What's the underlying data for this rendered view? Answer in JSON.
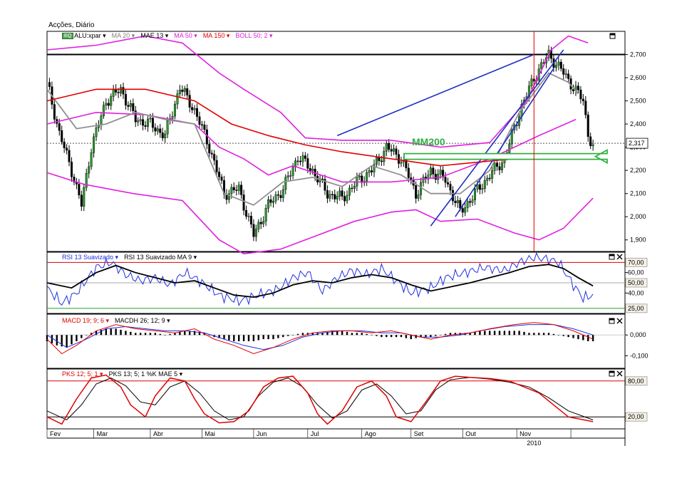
{
  "window_title": "Acções, Diário",
  "legend_price": {
    "eq_badge": "EQ",
    "symbol": "ALU:xpar ▾",
    "items": [
      {
        "text": "MA 20 ▾",
        "color": "#808080"
      },
      {
        "text": "MAE 13 ▾",
        "color": "#000000"
      },
      {
        "text": "MA 50 ▾",
        "color": "#e020e0"
      },
      {
        "text": "MA 150 ▾",
        "color": "#e00000"
      },
      {
        "text": "BOLL 50; 2 ▾",
        "color": "#e020e0"
      }
    ]
  },
  "legend_rsi": {
    "items": [
      {
        "text": "RSI 13 Suavizado ▾",
        "color": "#2030e0"
      },
      {
        "text": "RSI 13 Suavizado MA 9 ▾",
        "color": "#000000"
      }
    ]
  },
  "legend_macd": {
    "items": [
      {
        "text": "MACD 19; 9; 6 ▾",
        "color": "#e00000"
      },
      {
        "text": "MACDH 26; 12; 9 ▾",
        "color": "#000000"
      }
    ]
  },
  "legend_pks": {
    "items": [
      {
        "text": "PKS 12; 5; 1 ▾",
        "color": "#e00000"
      },
      {
        "text": "PKS 13; 5; 1 %K MAE 5 ▾",
        "color": "#000000"
      }
    ]
  },
  "annotation": {
    "text": "MM200",
    "color": "#30b040"
  },
  "price_readout": "2,317",
  "year_label": "2010",
  "chart_data": {
    "type": "line",
    "x_months": [
      "Fev",
      "Mar",
      "Abr",
      "Mai",
      "Jun",
      "Jul",
      "Ago",
      "Set",
      "Out",
      "Nov"
    ],
    "price_axis": {
      "ticks": [
        "2,700",
        "2,600",
        "2,500",
        "2,400",
        "2,300",
        "2,200",
        "2,100",
        "2,000",
        "1,900"
      ],
      "ylim": [
        1.85,
        2.8
      ]
    },
    "rsi_axis": {
      "ticks": [
        "70,00",
        "60,00",
        "50,00",
        "40,00",
        "25,00"
      ],
      "boxed": [
        "70,00",
        "50,00",
        "25,00"
      ],
      "ylim": [
        20,
        80
      ]
    },
    "macd_axis": {
      "ticks": [
        "0,000",
        "-0,100"
      ],
      "ylim": [
        -0.16,
        0.1
      ]
    },
    "pks_axis": {
      "ticks": [
        "80,00",
        "20,00"
      ],
      "boxed": [
        "80,00",
        "20,00"
      ],
      "ylim": [
        0,
        100
      ]
    },
    "close_points": [
      [
        0,
        2.58
      ],
      [
        5,
        2.36
      ],
      [
        10,
        2.2
      ],
      [
        14,
        2.05
      ],
      [
        18,
        2.3
      ],
      [
        24,
        2.5
      ],
      [
        30,
        2.55
      ],
      [
        36,
        2.42
      ],
      [
        42,
        2.4
      ],
      [
        48,
        2.35
      ],
      [
        54,
        2.56
      ],
      [
        60,
        2.46
      ],
      [
        66,
        2.3
      ],
      [
        72,
        2.1
      ],
      [
        78,
        2.12
      ],
      [
        84,
        1.92
      ],
      [
        90,
        2.05
      ],
      [
        96,
        2.12
      ],
      [
        102,
        2.26
      ],
      [
        108,
        2.2
      ],
      [
        114,
        2.1
      ],
      [
        120,
        2.08
      ],
      [
        126,
        2.15
      ],
      [
        132,
        2.2
      ],
      [
        138,
        2.3
      ],
      [
        144,
        2.25
      ],
      [
        150,
        2.1
      ],
      [
        156,
        2.2
      ],
      [
        162,
        2.16
      ],
      [
        168,
        2.02
      ],
      [
        174,
        2.1
      ],
      [
        180,
        2.18
      ],
      [
        186,
        2.25
      ],
      [
        192,
        2.45
      ],
      [
        198,
        2.6
      ],
      [
        204,
        2.7
      ],
      [
        210,
        2.62
      ],
      [
        214,
        2.56
      ],
      [
        218,
        2.5
      ],
      [
        220,
        2.36
      ],
      [
        222,
        2.3
      ]
    ],
    "ma20": [
      [
        0,
        2.55
      ],
      [
        12,
        2.38
      ],
      [
        24,
        2.4
      ],
      [
        36,
        2.45
      ],
      [
        48,
        2.42
      ],
      [
        60,
        2.4
      ],
      [
        72,
        2.1
      ],
      [
        84,
        2.05
      ],
      [
        96,
        2.15
      ],
      [
        108,
        2.17
      ],
      [
        120,
        2.13
      ],
      [
        132,
        2.22
      ],
      [
        144,
        2.18
      ],
      [
        156,
        2.1
      ],
      [
        168,
        2.1
      ],
      [
        180,
        2.2
      ],
      [
        192,
        2.45
      ],
      [
        204,
        2.62
      ],
      [
        212,
        2.58
      ],
      [
        216,
        2.53
      ]
    ],
    "ma50": [
      [
        0,
        2.4
      ],
      [
        20,
        2.45
      ],
      [
        40,
        2.44
      ],
      [
        60,
        2.4
      ],
      [
        70,
        2.3
      ],
      [
        80,
        2.25
      ],
      [
        90,
        2.18
      ],
      [
        100,
        2.22
      ],
      [
        120,
        2.15
      ],
      [
        140,
        2.15
      ],
      [
        160,
        2.17
      ],
      [
        180,
        2.25
      ],
      [
        200,
        2.35
      ],
      [
        215,
        2.42
      ]
    ],
    "ma150_mm200": [
      [
        0,
        2.5
      ],
      [
        20,
        2.55
      ],
      [
        40,
        2.55
      ],
      [
        60,
        2.5
      ],
      [
        75,
        2.4
      ],
      [
        90,
        2.35
      ],
      [
        105,
        2.31
      ],
      [
        120,
        2.28
      ],
      [
        140,
        2.25
      ],
      [
        160,
        2.22
      ],
      [
        180,
        2.24
      ],
      [
        200,
        2.26
      ],
      [
        222,
        2.26
      ]
    ],
    "boll_upper": [
      [
        0,
        2.72
      ],
      [
        20,
        2.74
      ],
      [
        40,
        2.78
      ],
      [
        55,
        2.75
      ],
      [
        70,
        2.62
      ],
      [
        80,
        2.55
      ],
      [
        95,
        2.45
      ],
      [
        105,
        2.34
      ],
      [
        120,
        2.33
      ],
      [
        140,
        2.33
      ],
      [
        160,
        2.3
      ],
      [
        180,
        2.32
      ],
      [
        195,
        2.5
      ],
      [
        205,
        2.72
      ],
      [
        212,
        2.78
      ],
      [
        220,
        2.75
      ]
    ],
    "boll_lower": [
      [
        0,
        2.19
      ],
      [
        15,
        2.14
      ],
      [
        35,
        2.1
      ],
      [
        55,
        2.07
      ],
      [
        70,
        1.9
      ],
      [
        80,
        1.84
      ],
      [
        95,
        1.86
      ],
      [
        110,
        1.92
      ],
      [
        125,
        1.98
      ],
      [
        140,
        2.02
      ],
      [
        150,
        2.03
      ],
      [
        160,
        1.98
      ],
      [
        175,
        1.99
      ],
      [
        190,
        1.93
      ],
      [
        200,
        1.9
      ],
      [
        210,
        1.95
      ],
      [
        222,
        2.08
      ]
    ],
    "trendlines": [
      {
        "from": [
          118,
          2.35
        ],
        "to": [
          198,
          2.7
        ],
        "color": "#2030c0"
      },
      {
        "from": [
          156,
          1.96
        ],
        "to": [
          210,
          2.72
        ],
        "color": "#2030c0"
      },
      {
        "from": [
          166,
          2.0
        ],
        "to": [
          206,
          2.64
        ],
        "color": "#2030c0"
      }
    ],
    "resistance_level": 2.7,
    "current_level": 2.317,
    "rsi": [
      [
        0,
        45
      ],
      [
        6,
        30
      ],
      [
        12,
        40
      ],
      [
        20,
        65
      ],
      [
        26,
        70
      ],
      [
        32,
        58
      ],
      [
        38,
        52
      ],
      [
        44,
        55
      ],
      [
        50,
        48
      ],
      [
        56,
        60
      ],
      [
        62,
        52
      ],
      [
        70,
        38
      ],
      [
        78,
        32
      ],
      [
        86,
        38
      ],
      [
        94,
        44
      ],
      [
        100,
        55
      ],
      [
        106,
        60
      ],
      [
        112,
        42
      ],
      [
        118,
        55
      ],
      [
        124,
        62
      ],
      [
        130,
        58
      ],
      [
        136,
        64
      ],
      [
        142,
        52
      ],
      [
        148,
        40
      ],
      [
        156,
        45
      ],
      [
        162,
        55
      ],
      [
        170,
        60
      ],
      [
        178,
        65
      ],
      [
        186,
        62
      ],
      [
        192,
        70
      ],
      [
        198,
        75
      ],
      [
        204,
        73
      ],
      [
        208,
        70
      ],
      [
        214,
        48
      ],
      [
        218,
        35
      ],
      [
        222,
        38
      ]
    ],
    "rsi_ma": [
      [
        0,
        50
      ],
      [
        10,
        45
      ],
      [
        20,
        60
      ],
      [
        28,
        67
      ],
      [
        36,
        60
      ],
      [
        44,
        55
      ],
      [
        52,
        50
      ],
      [
        60,
        52
      ],
      [
        68,
        45
      ],
      [
        76,
        38
      ],
      [
        84,
        36
      ],
      [
        92,
        40
      ],
      [
        100,
        48
      ],
      [
        108,
        52
      ],
      [
        116,
        50
      ],
      [
        124,
        55
      ],
      [
        132,
        58
      ],
      [
        140,
        55
      ],
      [
        148,
        48
      ],
      [
        156,
        42
      ],
      [
        164,
        46
      ],
      [
        172,
        50
      ],
      [
        180,
        55
      ],
      [
        188,
        60
      ],
      [
        196,
        66
      ],
      [
        204,
        68
      ],
      [
        210,
        64
      ],
      [
        216,
        55
      ],
      [
        222,
        47
      ]
    ],
    "macd": [
      [
        0,
        -0.02
      ],
      [
        6,
        -0.09
      ],
      [
        12,
        -0.05
      ],
      [
        20,
        0.02
      ],
      [
        28,
        0.05
      ],
      [
        36,
        0.03
      ],
      [
        44,
        0.02
      ],
      [
        52,
        0.01
      ],
      [
        60,
        0.03
      ],
      [
        68,
        -0.02
      ],
      [
        76,
        -0.05
      ],
      [
        84,
        -0.09
      ],
      [
        92,
        -0.06
      ],
      [
        100,
        -0.02
      ],
      [
        108,
        0.01
      ],
      [
        116,
        0.02
      ],
      [
        124,
        0.02
      ],
      [
        132,
        0.01
      ],
      [
        140,
        0.02
      ],
      [
        148,
        0.0
      ],
      [
        156,
        -0.02
      ],
      [
        164,
        0.0
      ],
      [
        172,
        0.01
      ],
      [
        180,
        0.03
      ],
      [
        190,
        0.05
      ],
      [
        198,
        0.06
      ],
      [
        206,
        0.05
      ],
      [
        214,
        0.02
      ],
      [
        222,
        -0.02
      ]
    ],
    "macd_signal": [
      [
        0,
        0.0
      ],
      [
        8,
        -0.06
      ],
      [
        16,
        -0.02
      ],
      [
        24,
        0.03
      ],
      [
        32,
        0.04
      ],
      [
        40,
        0.03
      ],
      [
        48,
        0.02
      ],
      [
        56,
        0.02
      ],
      [
        64,
        0.01
      ],
      [
        72,
        -0.02
      ],
      [
        80,
        -0.05
      ],
      [
        88,
        -0.07
      ],
      [
        96,
        -0.05
      ],
      [
        104,
        -0.01
      ],
      [
        112,
        0.01
      ],
      [
        120,
        0.02
      ],
      [
        128,
        0.02
      ],
      [
        136,
        0.01
      ],
      [
        144,
        0.01
      ],
      [
        152,
        -0.01
      ],
      [
        160,
        -0.01
      ],
      [
        168,
        0.0
      ],
      [
        176,
        0.02
      ],
      [
        186,
        0.04
      ],
      [
        196,
        0.05
      ],
      [
        206,
        0.05
      ],
      [
        214,
        0.03
      ],
      [
        222,
        0.0
      ]
    ],
    "macd_hist": [
      [
        0,
        -0.03
      ],
      [
        4,
        -0.05
      ],
      [
        8,
        -0.06
      ],
      [
        12,
        -0.03
      ],
      [
        16,
        0.0
      ],
      [
        20,
        0.02
      ],
      [
        24,
        0.03
      ],
      [
        28,
        0.03
      ],
      [
        32,
        0.02
      ],
      [
        36,
        0.01
      ],
      [
        40,
        0.01
      ],
      [
        44,
        0.01
      ],
      [
        48,
        0.0
      ],
      [
        52,
        0.01
      ],
      [
        56,
        0.02
      ],
      [
        60,
        0.02
      ],
      [
        64,
        0.01
      ],
      [
        68,
        -0.01
      ],
      [
        72,
        -0.02
      ],
      [
        76,
        -0.03
      ],
      [
        80,
        -0.03
      ],
      [
        84,
        -0.03
      ],
      [
        88,
        -0.02
      ],
      [
        92,
        -0.02
      ],
      [
        96,
        -0.01
      ],
      [
        100,
        0.0
      ],
      [
        104,
        0.01
      ],
      [
        108,
        0.01
      ],
      [
        112,
        0.01
      ],
      [
        116,
        0.02
      ],
      [
        120,
        0.02
      ],
      [
        124,
        0.01
      ],
      [
        128,
        0.01
      ],
      [
        132,
        0.0
      ],
      [
        136,
        -0.01
      ],
      [
        140,
        -0.01
      ],
      [
        144,
        -0.01
      ],
      [
        148,
        -0.02
      ],
      [
        152,
        -0.01
      ],
      [
        156,
        -0.01
      ],
      [
        160,
        0.0
      ],
      [
        164,
        0.01
      ],
      [
        168,
        0.01
      ],
      [
        172,
        0.01
      ],
      [
        176,
        0.02
      ],
      [
        180,
        0.02
      ],
      [
        184,
        0.02
      ],
      [
        188,
        0.02
      ],
      [
        192,
        0.02
      ],
      [
        196,
        0.01
      ],
      [
        200,
        0.01
      ],
      [
        204,
        0.01
      ],
      [
        208,
        0.0
      ],
      [
        212,
        -0.01
      ],
      [
        216,
        -0.02
      ],
      [
        220,
        -0.03
      ],
      [
        222,
        -0.03
      ]
    ],
    "pks": [
      [
        0,
        20
      ],
      [
        6,
        8
      ],
      [
        12,
        50
      ],
      [
        18,
        85
      ],
      [
        24,
        90
      ],
      [
        30,
        70
      ],
      [
        34,
        40
      ],
      [
        40,
        20
      ],
      [
        44,
        55
      ],
      [
        50,
        85
      ],
      [
        56,
        80
      ],
      [
        60,
        50
      ],
      [
        64,
        25
      ],
      [
        70,
        10
      ],
      [
        76,
        12
      ],
      [
        82,
        30
      ],
      [
        88,
        70
      ],
      [
        94,
        85
      ],
      [
        100,
        88
      ],
      [
        106,
        60
      ],
      [
        110,
        25
      ],
      [
        114,
        8
      ],
      [
        120,
        30
      ],
      [
        126,
        70
      ],
      [
        132,
        80
      ],
      [
        138,
        55
      ],
      [
        142,
        20
      ],
      [
        148,
        12
      ],
      [
        154,
        45
      ],
      [
        160,
        80
      ],
      [
        166,
        88
      ],
      [
        172,
        86
      ],
      [
        180,
        84
      ],
      [
        188,
        80
      ],
      [
        194,
        70
      ],
      [
        200,
        60
      ],
      [
        206,
        40
      ],
      [
        212,
        20
      ],
      [
        222,
        12
      ]
    ],
    "pks_ma": [
      [
        0,
        30
      ],
      [
        8,
        15
      ],
      [
        14,
        40
      ],
      [
        20,
        75
      ],
      [
        26,
        85
      ],
      [
        32,
        72
      ],
      [
        38,
        45
      ],
      [
        44,
        40
      ],
      [
        50,
        70
      ],
      [
        56,
        80
      ],
      [
        62,
        60
      ],
      [
        68,
        30
      ],
      [
        74,
        15
      ],
      [
        80,
        20
      ],
      [
        86,
        55
      ],
      [
        92,
        78
      ],
      [
        98,
        85
      ],
      [
        104,
        70
      ],
      [
        110,
        40
      ],
      [
        116,
        18
      ],
      [
        122,
        30
      ],
      [
        128,
        65
      ],
      [
        134,
        75
      ],
      [
        140,
        55
      ],
      [
        146,
        25
      ],
      [
        152,
        30
      ],
      [
        158,
        65
      ],
      [
        164,
        82
      ],
      [
        172,
        86
      ],
      [
        180,
        83
      ],
      [
        188,
        78
      ],
      [
        196,
        70
      ],
      [
        204,
        52
      ],
      [
        212,
        30
      ],
      [
        222,
        15
      ]
    ],
    "cursor_day": 198,
    "days_total": 235
  }
}
